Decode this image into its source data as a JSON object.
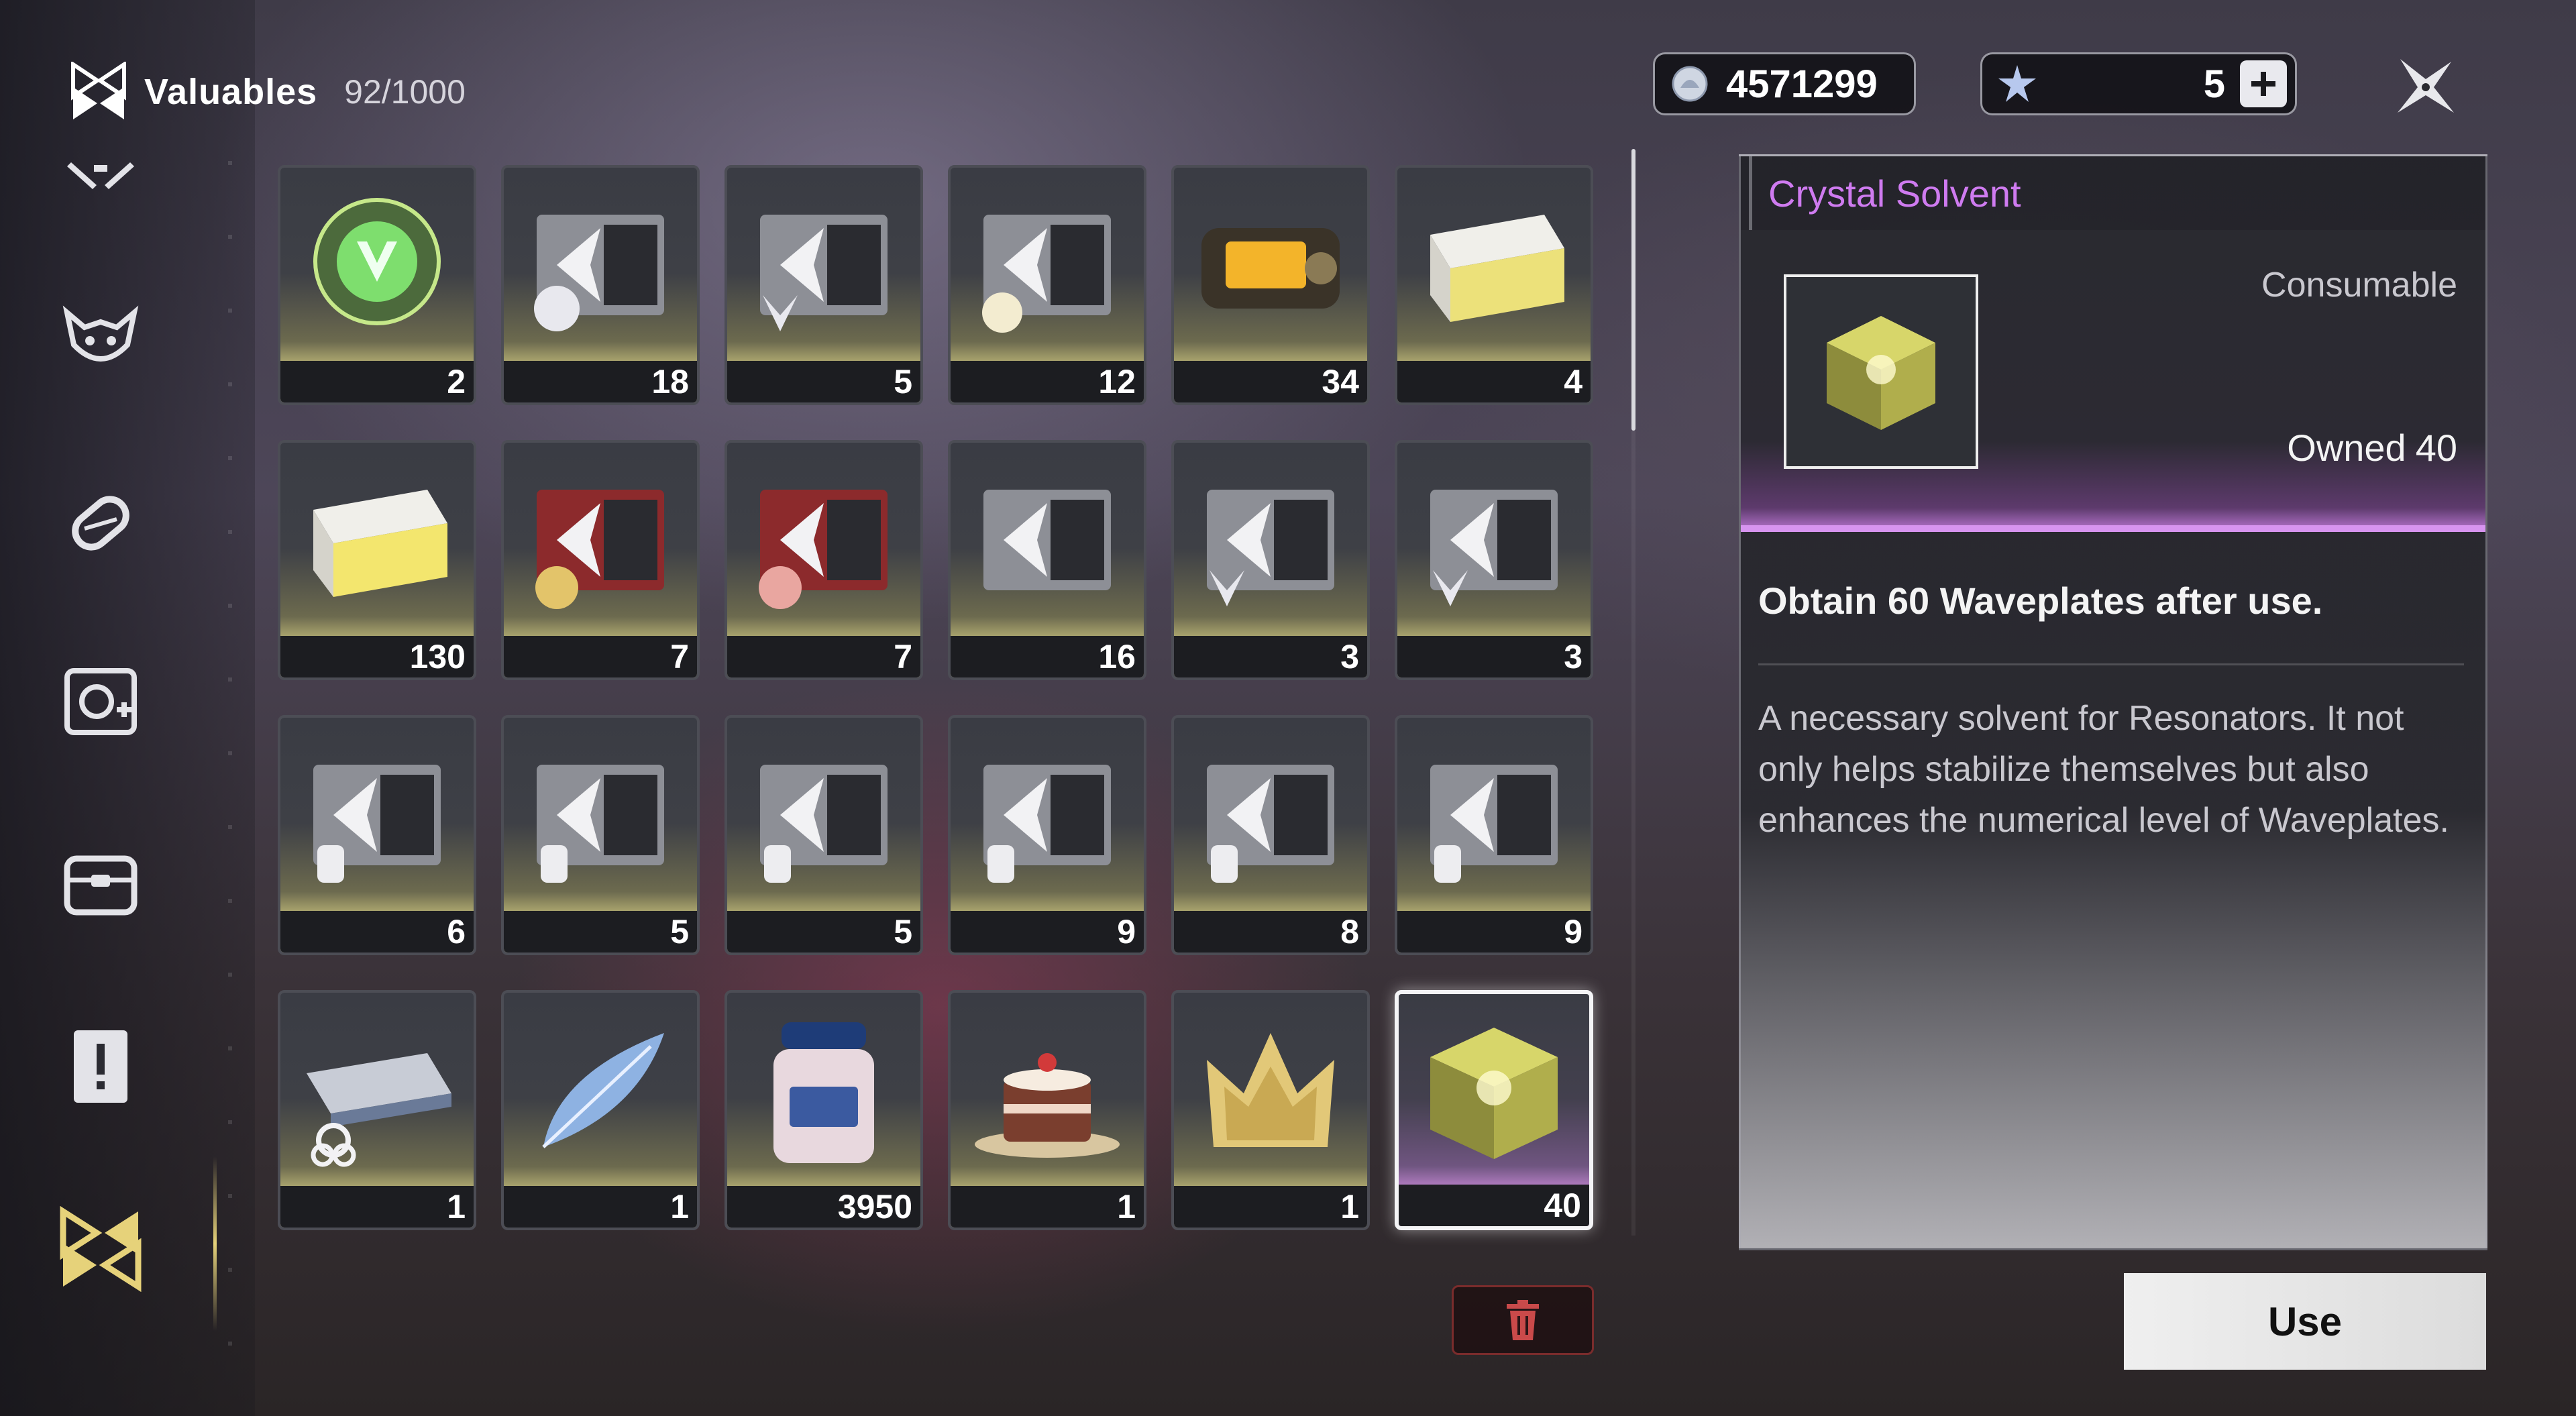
{
  "header": {
    "title": "Valuables",
    "count": "92/1000"
  },
  "currency": {
    "shell_credits": "4571299",
    "astrite": "5"
  },
  "nav": {
    "items": [
      {
        "icon": "crossed-weapons-icon",
        "active": false
      },
      {
        "icon": "echo-mask-icon",
        "active": false
      },
      {
        "icon": "material-capsule-icon",
        "active": false
      },
      {
        "icon": "development-item-icon",
        "active": false
      },
      {
        "icon": "resource-chest-icon",
        "active": false
      },
      {
        "icon": "mission-item-icon",
        "active": false
      },
      {
        "icon": "valuables-icon",
        "active": true
      }
    ],
    "accent": "#e6d27a"
  },
  "items": [
    {
      "name": "green-emblem",
      "count": "2"
    },
    {
      "name": "supply-chest-crab",
      "count": "18"
    },
    {
      "name": "supply-chest-wolf",
      "count": "5"
    },
    {
      "name": "supply-chest-fox",
      "count": "12"
    },
    {
      "name": "gold-capsule",
      "count": "34"
    },
    {
      "name": "white-case",
      "count": "4"
    },
    {
      "name": "yellow-case",
      "count": "130"
    },
    {
      "name": "red-chest-gold-emblem",
      "count": "7"
    },
    {
      "name": "red-chest-pink-emblem",
      "count": "7"
    },
    {
      "name": "supply-chest-plain",
      "count": "16"
    },
    {
      "name": "supply-chest-wolf-2",
      "count": "3"
    },
    {
      "name": "supply-chest-wolf-3",
      "count": "3"
    },
    {
      "name": "supply-chest-helm-1",
      "count": "6"
    },
    {
      "name": "supply-chest-helm-2",
      "count": "5"
    },
    {
      "name": "supply-chest-helm-3",
      "count": "5"
    },
    {
      "name": "supply-chest-helm-4",
      "count": "9"
    },
    {
      "name": "supply-chest-helm-5",
      "count": "8"
    },
    {
      "name": "supply-chest-helm-6",
      "count": "9"
    },
    {
      "name": "hoverboard-ticket",
      "count": "1"
    },
    {
      "name": "blue-feather",
      "count": "1"
    },
    {
      "name": "salt-jar",
      "count": "3950"
    },
    {
      "name": "cake",
      "count": "1"
    },
    {
      "name": "golden-crown",
      "count": "1"
    },
    {
      "name": "crystal-solvent",
      "count": "40"
    }
  ],
  "detail": {
    "name": "Crystal Solvent",
    "type": "Consumable",
    "owned_label": "Owned",
    "owned_count": "40",
    "effect": "Obtain 60 Waveplates after use.",
    "description": "A necessary solvent for Resonators. It not only helps stabilize themselves but also enhances the numerical level of Waveplates."
  },
  "actions": {
    "use_label": "Use"
  },
  "colors": {
    "title": "#cf7bf0",
    "selected_glow": "#d794f0",
    "trash": "#c94a4a"
  }
}
